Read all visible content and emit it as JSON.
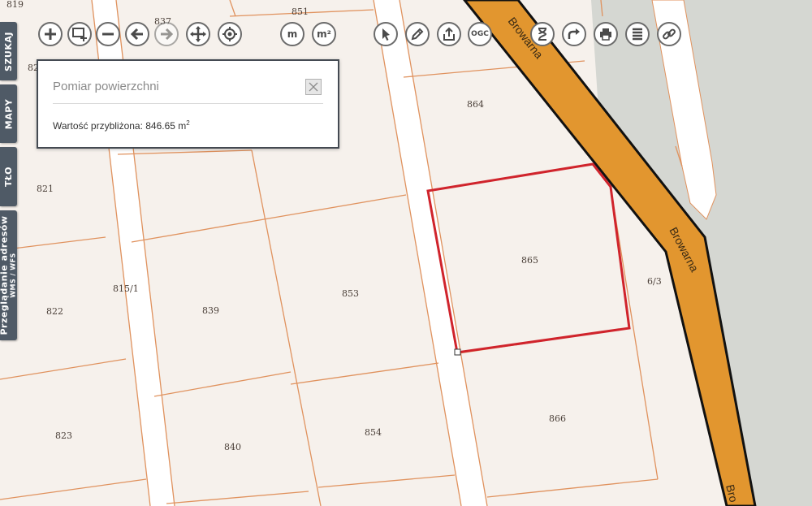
{
  "toolbar": {
    "left": [
      {
        "icon": "zoom-in-icon"
      },
      {
        "icon": "zoom-box-icon"
      },
      {
        "icon": "zoom-out-icon"
      },
      {
        "icon": "back-arrow-icon"
      },
      {
        "icon": "forward-arrow-icon",
        "disabled": true
      },
      {
        "icon": "pan-icon"
      },
      {
        "icon": "locate-icon"
      }
    ],
    "measure_length_label": "m",
    "measure_area_label": "m²",
    "right": [
      {
        "icon": "pointer-icon"
      },
      {
        "icon": "pencil-icon"
      },
      {
        "icon": "share-export-icon"
      },
      {
        "icon": "ogc-icon",
        "label": "OGC"
      },
      {
        "icon": "hourglass-icon"
      },
      {
        "icon": "redirect-arrow-icon"
      },
      {
        "icon": "print-icon"
      },
      {
        "icon": "layers-list-icon"
      },
      {
        "icon": "link-icon"
      }
    ]
  },
  "side_tabs": {
    "search": "SZUKAJ",
    "maps": "MAPY",
    "background": "TŁO",
    "services_main": "Przeglądanie adresów",
    "services_sub": "WMS / WFS"
  },
  "measure_dialog": {
    "title": "Pomiar powierzchni",
    "value_label": "Wartość przybliżona: 846.65 m",
    "unit_sup": "2"
  },
  "map": {
    "street_name": "Browarna",
    "street_color": "#e2962f",
    "highlight_color": "#d0242c",
    "parcel_line_color": "#e0925e",
    "selected_parcel": "865",
    "parcels": [
      "819",
      "837",
      "851",
      "82",
      "864",
      "865",
      "821",
      "815/1",
      "853",
      "822",
      "839",
      "6/3",
      "823",
      "840",
      "854",
      "866"
    ],
    "street_labels": [
      "Browarna",
      "Browarna",
      "Bro"
    ]
  }
}
